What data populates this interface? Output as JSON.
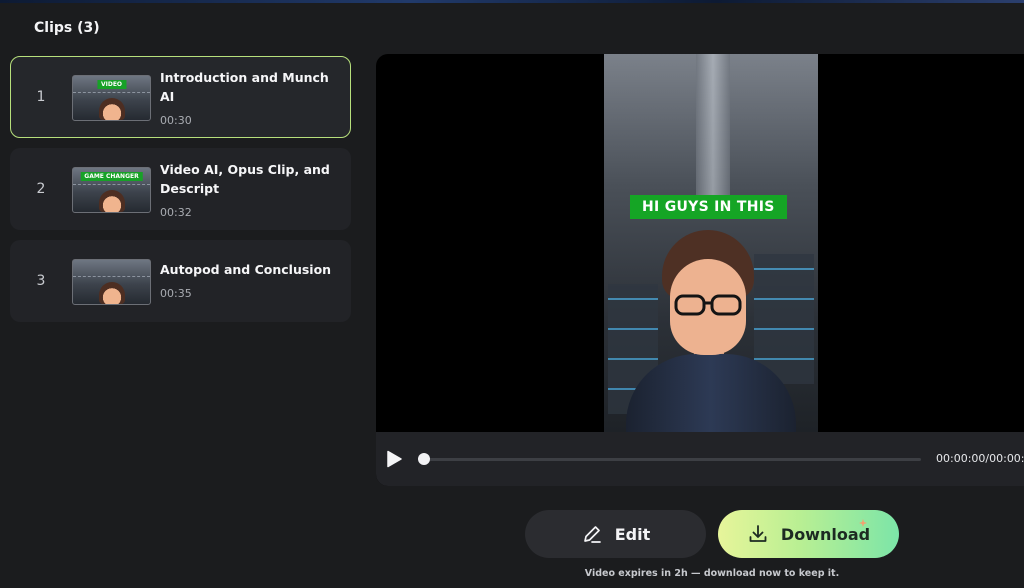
{
  "clips_panel": {
    "title": "Clips (3)",
    "items": [
      {
        "number": "1",
        "title": "Introduction and Munch AI",
        "duration": "00:30",
        "thumb_tag": "VIDEO",
        "selected": true
      },
      {
        "number": "2",
        "title": "Video AI, Opus Clip, and Descript",
        "duration": "00:32",
        "thumb_tag": "GAME CHANGER",
        "selected": false
      },
      {
        "number": "3",
        "title": "Autopod and Conclusion",
        "duration": "00:35",
        "thumb_tag": "",
        "selected": false
      }
    ]
  },
  "player": {
    "caption": "HI GUYS IN THIS",
    "time": "00:00:00/00:00:",
    "progress": 0.0,
    "play_icon": "play-icon"
  },
  "actions": {
    "edit_label": "Edit",
    "edit_icon": "pencil-icon",
    "download_label": "Download",
    "download_icon": "download-icon",
    "expires_note": "Video expires in 2h — download now to keep it."
  },
  "colors": {
    "selected_border": "#b7e07c",
    "caption_green": "#15a525",
    "download_gradient_start": "#e7f59a",
    "download_gradient_end": "#7ce5a8"
  }
}
